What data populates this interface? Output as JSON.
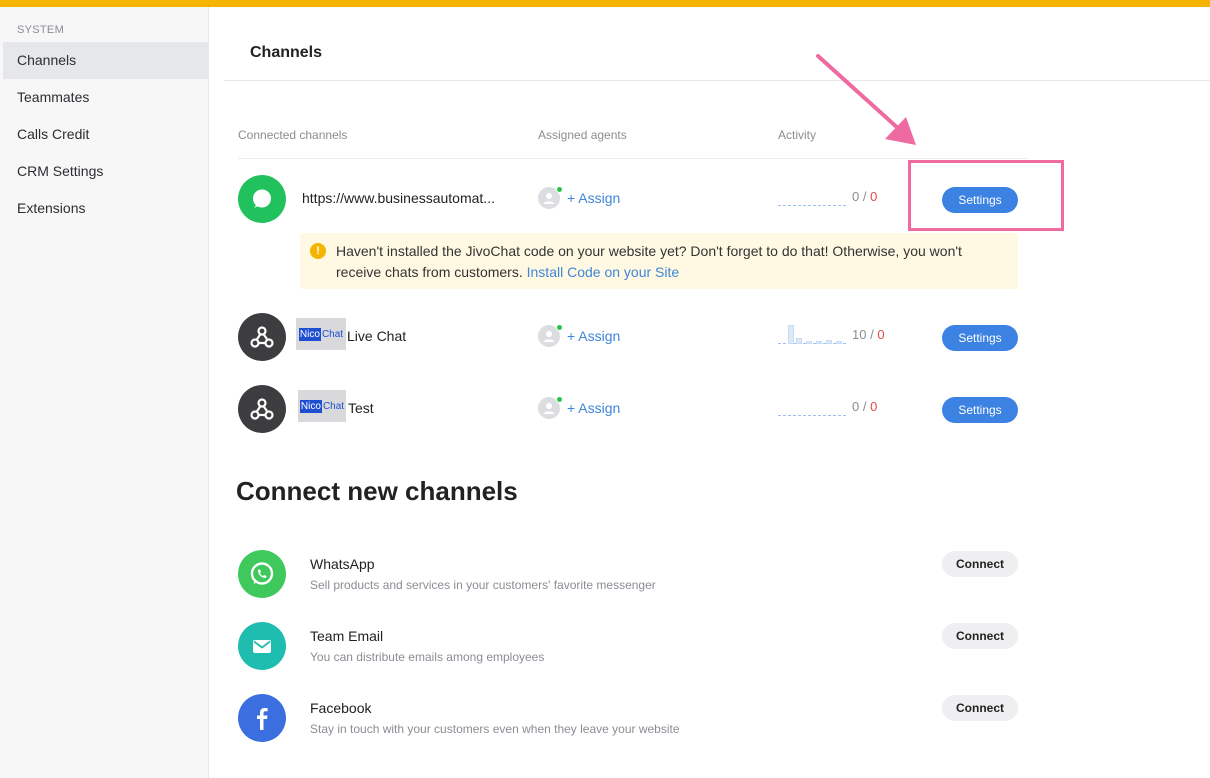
{
  "sidebar": {
    "section_label": "SYSTEM",
    "items": [
      {
        "label": "Channels",
        "active": true
      },
      {
        "label": "Teammates"
      },
      {
        "label": "Calls Credit"
      },
      {
        "label": "CRM Settings"
      },
      {
        "label": "Extensions"
      }
    ]
  },
  "header": {
    "title": "Channels"
  },
  "table": {
    "columns": [
      "Connected channels",
      "Assigned agents",
      "Activity"
    ],
    "rows": [
      {
        "name": "https://www.businessautomat...",
        "assign_label": "+ Assign",
        "count": "0",
        "missed": "0",
        "settings_label": "Settings",
        "icon": "chat-bubble-icon"
      },
      {
        "name": "Live Chat",
        "logo_nico": "Nico",
        "logo_chat": "Chat",
        "assign_label": "+ Assign",
        "count": "10",
        "missed": "0",
        "settings_label": "Settings",
        "icon": "webhook-icon"
      },
      {
        "name": "Test",
        "logo_nico": "Nico",
        "logo_chat": "Chat",
        "assign_label": "+ Assign",
        "count": "0",
        "missed": "0",
        "settings_label": "Settings",
        "icon": "webhook-icon"
      }
    ],
    "separator": "/"
  },
  "warning": {
    "text": "Haven't installed the JivoChat code on your website yet? Don't forget to do that! Otherwise, you won't receive chats from customers. ",
    "link": "Install Code on your Site",
    "icon": "!"
  },
  "connect_section": {
    "title": "Connect new channels",
    "items": [
      {
        "title": "WhatsApp",
        "desc": "Sell products and services in your customers' favorite messenger",
        "button": "Connect",
        "icon": "whatsapp-icon"
      },
      {
        "title": "Team Email",
        "desc": "You can distribute emails among employees",
        "button": "Connect",
        "icon": "envelope-icon"
      },
      {
        "title": "Facebook",
        "desc": "Stay in touch with your customers even when they leave your website",
        "button": "Connect",
        "icon": "facebook-icon"
      }
    ]
  },
  "colors": {
    "accent": "#3c82e2",
    "topbar": "#f5b400",
    "highlight": "#ef6aa0",
    "missed": "#e44a4a"
  }
}
